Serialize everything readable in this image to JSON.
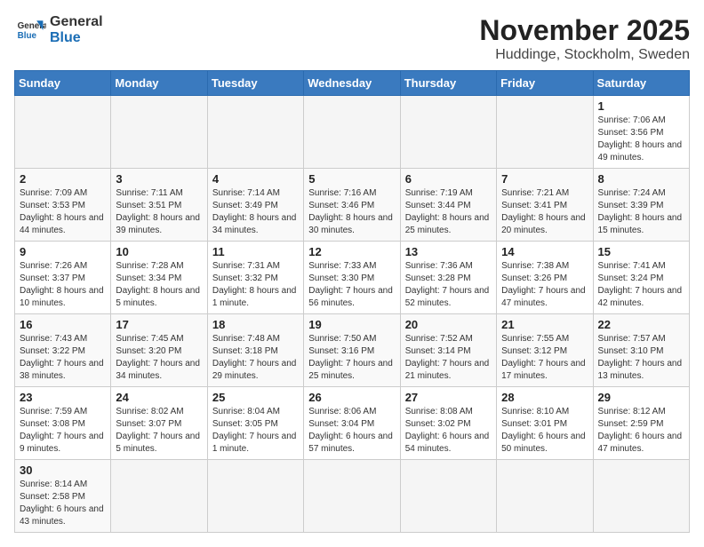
{
  "header": {
    "logo_general": "General",
    "logo_blue": "Blue",
    "month_title": "November 2025",
    "location": "Huddinge, Stockholm, Sweden"
  },
  "weekdays": [
    "Sunday",
    "Monday",
    "Tuesday",
    "Wednesday",
    "Thursday",
    "Friday",
    "Saturday"
  ],
  "weeks": [
    [
      {
        "day": null
      },
      {
        "day": null
      },
      {
        "day": null
      },
      {
        "day": null
      },
      {
        "day": null
      },
      {
        "day": null
      },
      {
        "day": "1",
        "sunrise": "Sunrise: 7:06 AM",
        "sunset": "Sunset: 3:56 PM",
        "daylight": "Daylight: 8 hours and 49 minutes."
      }
    ],
    [
      {
        "day": "2",
        "sunrise": "Sunrise: 7:09 AM",
        "sunset": "Sunset: 3:53 PM",
        "daylight": "Daylight: 8 hours and 44 minutes."
      },
      {
        "day": "3",
        "sunrise": "Sunrise: 7:11 AM",
        "sunset": "Sunset: 3:51 PM",
        "daylight": "Daylight: 8 hours and 39 minutes."
      },
      {
        "day": "4",
        "sunrise": "Sunrise: 7:14 AM",
        "sunset": "Sunset: 3:49 PM",
        "daylight": "Daylight: 8 hours and 34 minutes."
      },
      {
        "day": "5",
        "sunrise": "Sunrise: 7:16 AM",
        "sunset": "Sunset: 3:46 PM",
        "daylight": "Daylight: 8 hours and 30 minutes."
      },
      {
        "day": "6",
        "sunrise": "Sunrise: 7:19 AM",
        "sunset": "Sunset: 3:44 PM",
        "daylight": "Daylight: 8 hours and 25 minutes."
      },
      {
        "day": "7",
        "sunrise": "Sunrise: 7:21 AM",
        "sunset": "Sunset: 3:41 PM",
        "daylight": "Daylight: 8 hours and 20 minutes."
      },
      {
        "day": "8",
        "sunrise": "Sunrise: 7:24 AM",
        "sunset": "Sunset: 3:39 PM",
        "daylight": "Daylight: 8 hours and 15 minutes."
      }
    ],
    [
      {
        "day": "9",
        "sunrise": "Sunrise: 7:26 AM",
        "sunset": "Sunset: 3:37 PM",
        "daylight": "Daylight: 8 hours and 10 minutes."
      },
      {
        "day": "10",
        "sunrise": "Sunrise: 7:28 AM",
        "sunset": "Sunset: 3:34 PM",
        "daylight": "Daylight: 8 hours and 5 minutes."
      },
      {
        "day": "11",
        "sunrise": "Sunrise: 7:31 AM",
        "sunset": "Sunset: 3:32 PM",
        "daylight": "Daylight: 8 hours and 1 minute."
      },
      {
        "day": "12",
        "sunrise": "Sunrise: 7:33 AM",
        "sunset": "Sunset: 3:30 PM",
        "daylight": "Daylight: 7 hours and 56 minutes."
      },
      {
        "day": "13",
        "sunrise": "Sunrise: 7:36 AM",
        "sunset": "Sunset: 3:28 PM",
        "daylight": "Daylight: 7 hours and 52 minutes."
      },
      {
        "day": "14",
        "sunrise": "Sunrise: 7:38 AM",
        "sunset": "Sunset: 3:26 PM",
        "daylight": "Daylight: 7 hours and 47 minutes."
      },
      {
        "day": "15",
        "sunrise": "Sunrise: 7:41 AM",
        "sunset": "Sunset: 3:24 PM",
        "daylight": "Daylight: 7 hours and 42 minutes."
      }
    ],
    [
      {
        "day": "16",
        "sunrise": "Sunrise: 7:43 AM",
        "sunset": "Sunset: 3:22 PM",
        "daylight": "Daylight: 7 hours and 38 minutes."
      },
      {
        "day": "17",
        "sunrise": "Sunrise: 7:45 AM",
        "sunset": "Sunset: 3:20 PM",
        "daylight": "Daylight: 7 hours and 34 minutes."
      },
      {
        "day": "18",
        "sunrise": "Sunrise: 7:48 AM",
        "sunset": "Sunset: 3:18 PM",
        "daylight": "Daylight: 7 hours and 29 minutes."
      },
      {
        "day": "19",
        "sunrise": "Sunrise: 7:50 AM",
        "sunset": "Sunset: 3:16 PM",
        "daylight": "Daylight: 7 hours and 25 minutes."
      },
      {
        "day": "20",
        "sunrise": "Sunrise: 7:52 AM",
        "sunset": "Sunset: 3:14 PM",
        "daylight": "Daylight: 7 hours and 21 minutes."
      },
      {
        "day": "21",
        "sunrise": "Sunrise: 7:55 AM",
        "sunset": "Sunset: 3:12 PM",
        "daylight": "Daylight: 7 hours and 17 minutes."
      },
      {
        "day": "22",
        "sunrise": "Sunrise: 7:57 AM",
        "sunset": "Sunset: 3:10 PM",
        "daylight": "Daylight: 7 hours and 13 minutes."
      }
    ],
    [
      {
        "day": "23",
        "sunrise": "Sunrise: 7:59 AM",
        "sunset": "Sunset: 3:08 PM",
        "daylight": "Daylight: 7 hours and 9 minutes."
      },
      {
        "day": "24",
        "sunrise": "Sunrise: 8:02 AM",
        "sunset": "Sunset: 3:07 PM",
        "daylight": "Daylight: 7 hours and 5 minutes."
      },
      {
        "day": "25",
        "sunrise": "Sunrise: 8:04 AM",
        "sunset": "Sunset: 3:05 PM",
        "daylight": "Daylight: 7 hours and 1 minute."
      },
      {
        "day": "26",
        "sunrise": "Sunrise: 8:06 AM",
        "sunset": "Sunset: 3:04 PM",
        "daylight": "Daylight: 6 hours and 57 minutes."
      },
      {
        "day": "27",
        "sunrise": "Sunrise: 8:08 AM",
        "sunset": "Sunset: 3:02 PM",
        "daylight": "Daylight: 6 hours and 54 minutes."
      },
      {
        "day": "28",
        "sunrise": "Sunrise: 8:10 AM",
        "sunset": "Sunset: 3:01 PM",
        "daylight": "Daylight: 6 hours and 50 minutes."
      },
      {
        "day": "29",
        "sunrise": "Sunrise: 8:12 AM",
        "sunset": "Sunset: 2:59 PM",
        "daylight": "Daylight: 6 hours and 47 minutes."
      }
    ],
    [
      {
        "day": "30",
        "sunrise": "Sunrise: 8:14 AM",
        "sunset": "Sunset: 2:58 PM",
        "daylight": "Daylight: 6 hours and 43 minutes."
      },
      {
        "day": null
      },
      {
        "day": null
      },
      {
        "day": null
      },
      {
        "day": null
      },
      {
        "day": null
      },
      {
        "day": null
      }
    ]
  ]
}
